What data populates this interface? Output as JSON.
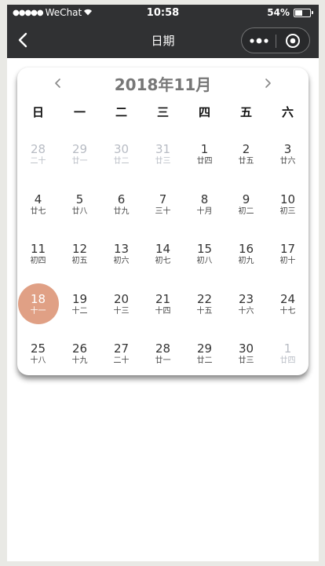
{
  "status_bar": {
    "carrier": "WeChat",
    "time": "10:58",
    "battery": "54%",
    "battery_level": 0.54
  },
  "nav": {
    "title": "日期",
    "back_icon": "chevron-left-icon",
    "more_icon": "more-dots-icon",
    "close_icon": "target-circle-icon"
  },
  "calendar": {
    "month_title": "2018年11月",
    "prev_icon": "chevron-left-icon",
    "next_icon": "chevron-right-icon",
    "weekdays": [
      "日",
      "一",
      "二",
      "三",
      "四",
      "五",
      "六"
    ],
    "selected_color": "#e0a085",
    "weeks": [
      [
        {
          "day": "28",
          "lunar": "二十",
          "other": true
        },
        {
          "day": "29",
          "lunar": "廿一",
          "other": true
        },
        {
          "day": "30",
          "lunar": "廿二",
          "other": true
        },
        {
          "day": "31",
          "lunar": "廿三",
          "other": true
        },
        {
          "day": "1",
          "lunar": "廿四",
          "other": false
        },
        {
          "day": "2",
          "lunar": "廿五",
          "other": false
        },
        {
          "day": "3",
          "lunar": "廿六",
          "other": false
        }
      ],
      [
        {
          "day": "4",
          "lunar": "廿七",
          "other": false
        },
        {
          "day": "5",
          "lunar": "廿八",
          "other": false
        },
        {
          "day": "6",
          "lunar": "廿九",
          "other": false
        },
        {
          "day": "7",
          "lunar": "三十",
          "other": false
        },
        {
          "day": "8",
          "lunar": "十月",
          "other": false
        },
        {
          "day": "9",
          "lunar": "初二",
          "other": false
        },
        {
          "day": "10",
          "lunar": "初三",
          "other": false
        }
      ],
      [
        {
          "day": "11",
          "lunar": "初四",
          "other": false
        },
        {
          "day": "12",
          "lunar": "初五",
          "other": false
        },
        {
          "day": "13",
          "lunar": "初六",
          "other": false
        },
        {
          "day": "14",
          "lunar": "初七",
          "other": false
        },
        {
          "day": "15",
          "lunar": "初八",
          "other": false
        },
        {
          "day": "16",
          "lunar": "初九",
          "other": false
        },
        {
          "day": "17",
          "lunar": "初十",
          "other": false
        }
      ],
      [
        {
          "day": "18",
          "lunar": "十一",
          "other": false,
          "selected": true
        },
        {
          "day": "19",
          "lunar": "十二",
          "other": false
        },
        {
          "day": "20",
          "lunar": "十三",
          "other": false
        },
        {
          "day": "21",
          "lunar": "十四",
          "other": false
        },
        {
          "day": "22",
          "lunar": "十五",
          "other": false
        },
        {
          "day": "23",
          "lunar": "十六",
          "other": false
        },
        {
          "day": "24",
          "lunar": "十七",
          "other": false
        }
      ],
      [
        {
          "day": "25",
          "lunar": "十八",
          "other": false
        },
        {
          "day": "26",
          "lunar": "十九",
          "other": false
        },
        {
          "day": "27",
          "lunar": "二十",
          "other": false
        },
        {
          "day": "28",
          "lunar": "廿一",
          "other": false
        },
        {
          "day": "29",
          "lunar": "廿二",
          "other": false
        },
        {
          "day": "30",
          "lunar": "廿三",
          "other": false
        },
        {
          "day": "1",
          "lunar": "廿四",
          "other": true
        }
      ]
    ]
  }
}
